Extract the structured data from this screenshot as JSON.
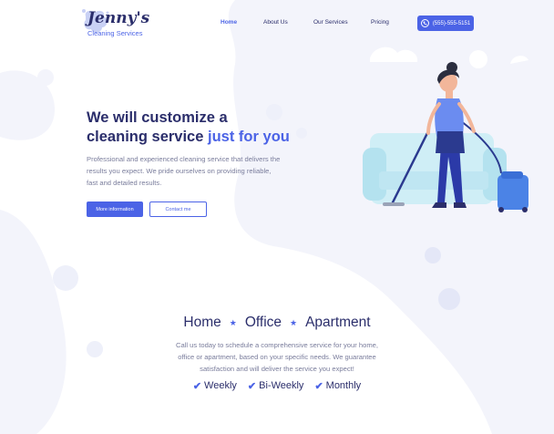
{
  "brand": {
    "name": "Jenny's",
    "tagline": "Cleaning Services"
  },
  "nav": {
    "items": [
      {
        "label": "Home",
        "active": true
      },
      {
        "label": "About Us",
        "active": false
      },
      {
        "label": "Our Services",
        "active": false
      },
      {
        "label": "Pricing",
        "active": false
      }
    ],
    "phone": "(555)-555-5151",
    "phone_icon": "phone-icon"
  },
  "hero": {
    "title_line1": "We will customize a",
    "title_line2": "cleaning service",
    "title_accent": "just for you",
    "description": "Professional and experienced cleaning service that delivers the results you expect. We pride ourselves on providing reliable, fast and detailed results.",
    "primary_button": "More information",
    "secondary_button": "Contact me"
  },
  "services": {
    "types": [
      "Home",
      "Office",
      "Apartment"
    ],
    "separator": "★",
    "description": "Call us today to schedule a comprehensive service for your home, office or apartment, based on your specific needs. We guarantee satisfaction and will deliver the service you expect!",
    "frequencies": [
      "Weekly",
      "Bi-Weekly",
      "Monthly"
    ],
    "check_icon": "check-icon"
  },
  "colors": {
    "primary": "#4b63e6",
    "heading": "#2b2e6b",
    "body_text": "#7a7d9c",
    "background_blob": "#f3f4fb"
  }
}
